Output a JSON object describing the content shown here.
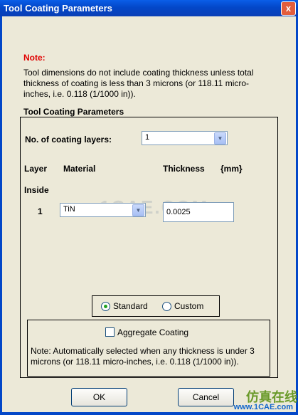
{
  "window": {
    "title": "Tool Coating Parameters",
    "close_glyph": "x"
  },
  "note": {
    "title": "Note:",
    "body": "Tool dimensions do not include coating thickness unless total thickness of coating is less than 3 microns (or 118.11 micro-inches, i.e. 0.118 (1/1000 in))."
  },
  "section": {
    "title": "Tool Coating Parameters",
    "num_layers_label": "No. of coating layers:",
    "num_layers_value": "1",
    "headers": {
      "layer": "Layer",
      "material": "Material",
      "thickness": "Thickness",
      "unit": "{mm}"
    },
    "inside_label": "Inside",
    "rows": [
      {
        "layer": "1",
        "material": "TiN",
        "thickness": "0.0025"
      }
    ]
  },
  "units": {
    "standard": "Standard",
    "custom": "Custom",
    "selected": "standard"
  },
  "aggregate": {
    "label": "Aggregate Coating",
    "checked": false,
    "note": "Note: Automatically selected when any thickness is under 3 microns (or 118.11 micro-inches, i.e. 0.118 (1/1000 in))."
  },
  "buttons": {
    "ok": "OK",
    "cancel": "Cancel"
  },
  "watermark": {
    "text": "1CAE.COM",
    "brand_cn": "仿真在线",
    "brand_url": "www.1CAE.com"
  },
  "icons": {
    "dropdown": "chevron-down-icon",
    "radio_selected_color": "#21a121"
  }
}
